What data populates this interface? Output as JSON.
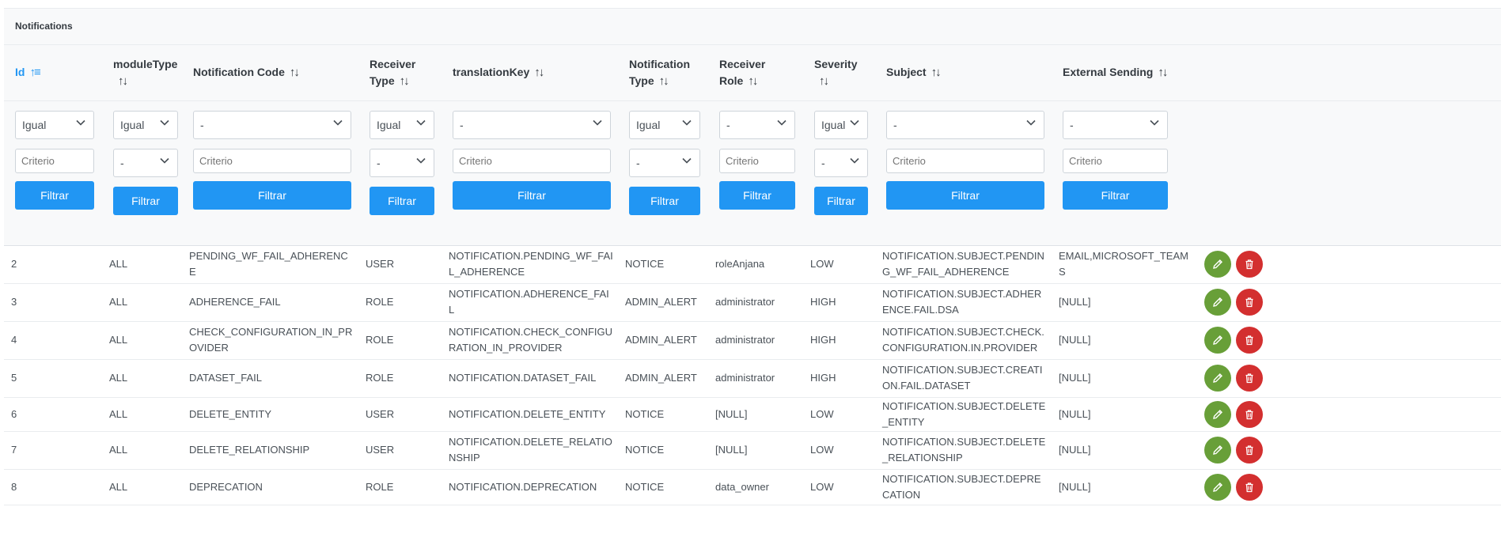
{
  "panel": {
    "title": "Notifications"
  },
  "columns": [
    {
      "key": "id",
      "label": "Id",
      "sorted": true,
      "filter": {
        "select": "Igual",
        "input_placeholder": "Criterio",
        "button": "Filtrar"
      }
    },
    {
      "key": "moduleType",
      "label": "moduleType",
      "filter": {
        "select": "Igual",
        "select2": "-",
        "button": "Filtrar"
      }
    },
    {
      "key": "code",
      "label": "Notification Code",
      "filter": {
        "select": "-",
        "input_placeholder": "Criterio",
        "button": "Filtrar"
      }
    },
    {
      "key": "receiverType",
      "label": "Receiver Type",
      "filter": {
        "select": "Igual",
        "select2": "-",
        "button": "Filtrar"
      }
    },
    {
      "key": "translationKey",
      "label": "translationKey",
      "filter": {
        "select": "-",
        "input_placeholder": "Criterio",
        "button": "Filtrar"
      }
    },
    {
      "key": "notificationType",
      "label": "Notification Type",
      "filter": {
        "select": "Igual",
        "select2": "-",
        "button": "Filtrar"
      }
    },
    {
      "key": "receiverRole",
      "label": "Receiver Role",
      "filter": {
        "select": "-",
        "input_placeholder": "Criterio",
        "button": "Filtrar"
      }
    },
    {
      "key": "severity",
      "label": "Severity",
      "filter": {
        "select": "Igual",
        "select2": "-",
        "button": "Filtrar"
      }
    },
    {
      "key": "subject",
      "label": "Subject",
      "filter": {
        "select": "-",
        "input_placeholder": "Criterio",
        "button": "Filtrar"
      }
    },
    {
      "key": "externalSending",
      "label": "External Sending",
      "filter": {
        "select": "-",
        "input_placeholder": "Criterio",
        "button": "Filtrar"
      }
    }
  ],
  "rows": [
    [
      "2",
      "ALL",
      "PENDING_WF_FAIL_ADHERENCE",
      "USER",
      "NOTIFICATION.PENDING_WF_FAIL_ADHERENCE",
      "NOTICE",
      "roleAnjana",
      "LOW",
      "NOTIFICATION.SUBJECT.PENDING_WF_FAIL_ADHERENCE",
      "EMAIL,MICROSOFT_TEAMS"
    ],
    [
      "3",
      "ALL",
      "ADHERENCE_FAIL",
      "ROLE",
      "NOTIFICATION.ADHERENCE_FAIL",
      "ADMIN_ALERT",
      "administrator",
      "HIGH",
      "NOTIFICATION.SUBJECT.ADHERENCE.FAIL.DSA",
      "[NULL]"
    ],
    [
      "4",
      "ALL",
      "CHECK_CONFIGURATION_IN_PROVIDER",
      "ROLE",
      "NOTIFICATION.CHECK_CONFIGURATION_IN_PROVIDER",
      "ADMIN_ALERT",
      "administrator",
      "HIGH",
      "NOTIFICATION.SUBJECT.CHECK.CONFIGURATION.IN.PROVIDER",
      "[NULL]"
    ],
    [
      "5",
      "ALL",
      "DATASET_FAIL",
      "ROLE",
      "NOTIFICATION.DATASET_FAIL",
      "ADMIN_ALERT",
      "administrator",
      "HIGH",
      "NOTIFICATION.SUBJECT.CREATION.FAIL.DATASET",
      "[NULL]"
    ],
    [
      "6",
      "ALL",
      "DELETE_ENTITY",
      "USER",
      "NOTIFICATION.DELETE_ENTITY",
      "NOTICE",
      "[NULL]",
      "LOW",
      "NOTIFICATION.SUBJECT.DELETE_ENTITY",
      "[NULL]"
    ],
    [
      "7",
      "ALL",
      "DELETE_RELATIONSHIP",
      "USER",
      "NOTIFICATION.DELETE_RELATIONSHIP",
      "NOTICE",
      "[NULL]",
      "LOW",
      "NOTIFICATION.SUBJECT.DELETE_RELATIONSHIP",
      "[NULL]"
    ],
    [
      "8",
      "ALL",
      "DEPRECATION",
      "ROLE",
      "NOTIFICATION.DEPRECATION",
      "NOTICE",
      "data_owner",
      "LOW",
      "NOTIFICATION.SUBJECT.DEPRECATION",
      "[NULL]"
    ]
  ],
  "actions": {
    "edit_icon": "pencil-icon",
    "delete_icon": "trash-icon"
  },
  "colors": {
    "primary": "#2196f3",
    "edit": "#689f38",
    "delete": "#d32f2f"
  }
}
